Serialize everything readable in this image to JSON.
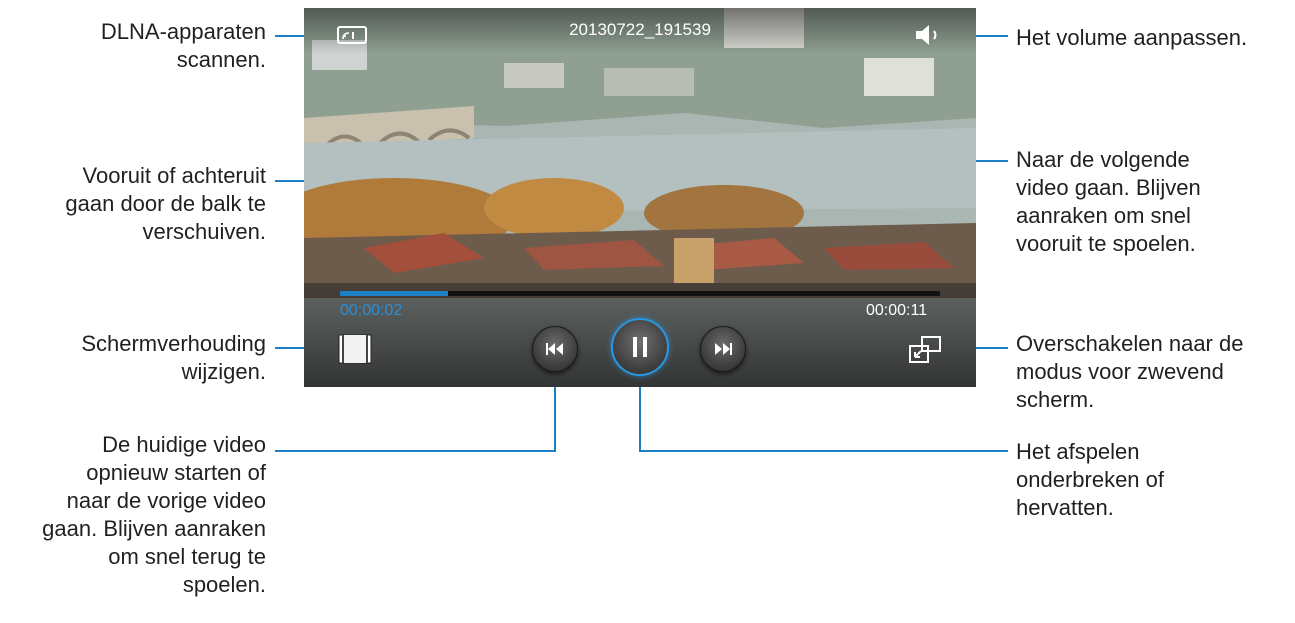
{
  "player": {
    "file_title": "20130722_191539",
    "elapsed_time": "00:00:02",
    "total_time": "00:00:11",
    "progress_fraction": 0.18,
    "accent_color": "#1d7fc6"
  },
  "annotations": {
    "dlna": "DLNA-apparaten\nscannen.",
    "seek": "Vooruit of achteruit\ngaan door de balk te\nverschuiven.",
    "aspect": "Schermverhouding\nwijzigen.",
    "previous": "De huidige video\nopnieuw starten of\nnaar de vorige video\ngaan. Blijven aanraken\nom snel terug te\nspoelen.",
    "volume": "Het volume aanpassen.",
    "next": "Naar de volgende\nvideo gaan. Blijven\naanraken om snel\nvooruit te spoelen.",
    "popup": "Overschakelen naar de\nmodus voor zwevend\nscherm.",
    "pause": "Het afspelen\nonderbreken of\nhervatten."
  },
  "icons": {
    "dlna": "dlna-icon",
    "volume": "speaker-icon",
    "aspect": "aspect-ratio-icon",
    "previous": "skip-previous-icon",
    "pause": "pause-icon",
    "next": "skip-next-icon",
    "popup": "popup-window-icon"
  }
}
